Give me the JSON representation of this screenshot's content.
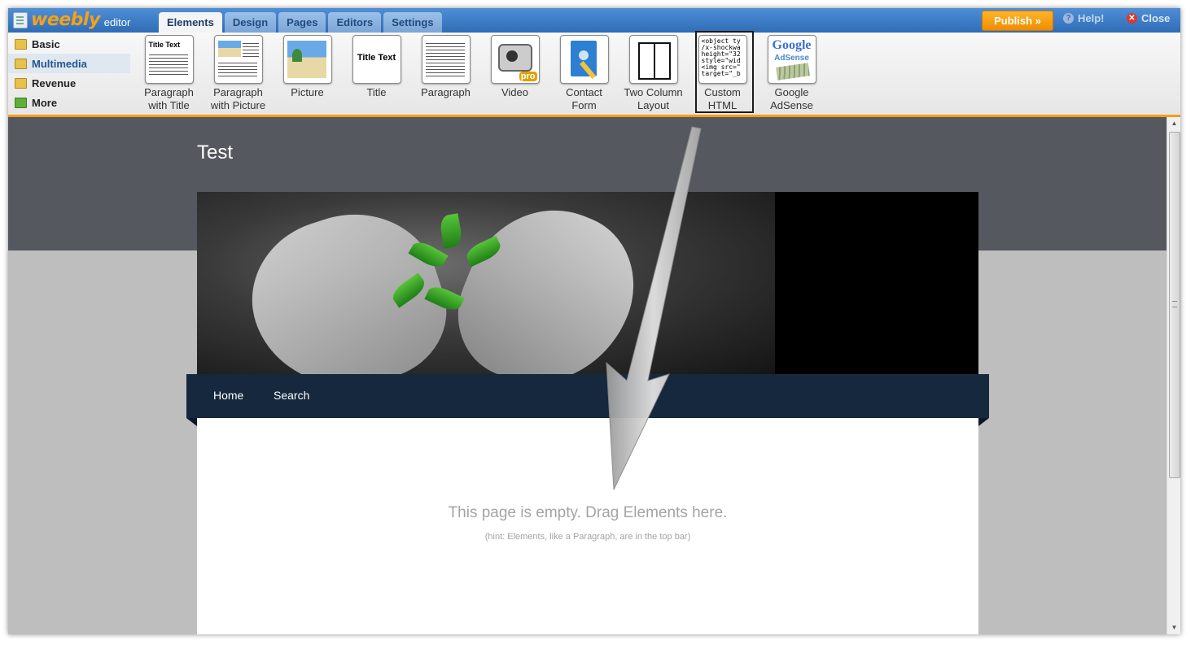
{
  "app": {
    "logo_text": "weebly",
    "logo_sub": "editor"
  },
  "tabs": [
    {
      "label": "Elements"
    },
    {
      "label": "Design"
    },
    {
      "label": "Pages"
    },
    {
      "label": "Editors"
    },
    {
      "label": "Settings"
    }
  ],
  "actions": {
    "publish": "Publish »",
    "help": "Help!",
    "close": "Close"
  },
  "categories": [
    {
      "label": "Basic"
    },
    {
      "label": "Multimedia"
    },
    {
      "label": "Revenue"
    },
    {
      "label": "More"
    }
  ],
  "elements": [
    {
      "line1": "Paragraph",
      "line2": "with Title"
    },
    {
      "line1": "Paragraph",
      "line2": "with Picture"
    },
    {
      "line1": "Picture",
      "line2": ""
    },
    {
      "line1": "Title",
      "line2": ""
    },
    {
      "line1": "Paragraph",
      "line2": ""
    },
    {
      "line1": "Video",
      "line2": ""
    },
    {
      "line1": "Contact",
      "line2": "Form"
    },
    {
      "line1": "Two Column",
      "line2": "Layout"
    },
    {
      "line1": "Custom",
      "line2": "HTML"
    },
    {
      "line1": "Google",
      "line2": "AdSense"
    }
  ],
  "thumbs": {
    "title_text": "Title Text",
    "code_sample": "<object ty\n/x-shockwa\nheight=\"32\nstyle=\"wid\n<img src=\"\ntarget=\"_b",
    "google": "Google",
    "adsense": "AdSense",
    "pro": "pro"
  },
  "site": {
    "title": "Test"
  },
  "nav": [
    {
      "label": "Home"
    },
    {
      "label": "Search"
    }
  ],
  "content": {
    "empty_message": "This page is empty. Drag Elements here.",
    "hint": "(hint: Elements, like a Paragraph, are in the top bar)"
  },
  "colors": {
    "accent_orange": "#f39c1c",
    "topbar_blue": "#2f6cb6",
    "nav_dark": "#16283e"
  }
}
